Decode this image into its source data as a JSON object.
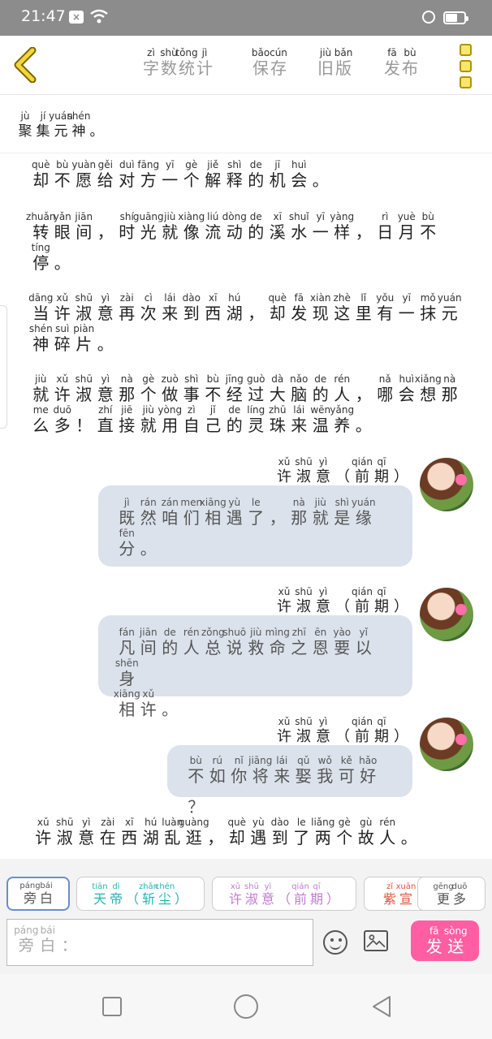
{
  "status": {
    "time": "21:47"
  },
  "toolbar": {
    "items": [
      {
        "name": "word-count",
        "chars": [
          [
            "zì",
            "字"
          ],
          [
            "shù",
            "数"
          ],
          [
            "tǒng",
            "统"
          ],
          [
            "jì",
            "计"
          ]
        ]
      },
      {
        "name": "save",
        "chars": [
          [
            "bǎo",
            "保"
          ],
          [
            "cún",
            "存"
          ]
        ]
      },
      {
        "name": "old-version",
        "chars": [
          [
            "jiù",
            "旧"
          ],
          [
            "bǎn",
            "版"
          ]
        ]
      },
      {
        "name": "publish",
        "chars": [
          [
            "fā",
            "发"
          ],
          [
            "bù",
            "布"
          ]
        ]
      }
    ]
  },
  "header_note": [
    [
      "jù",
      "聚"
    ],
    [
      "jí",
      "集"
    ],
    [
      "yuán",
      "元"
    ],
    [
      "shén",
      "神"
    ],
    [
      "",
      "。"
    ]
  ],
  "narration": [
    {
      "lines": [
        [
          [
            "què",
            "却"
          ],
          [
            "bù",
            "不"
          ],
          [
            "yuàn",
            "愿"
          ],
          [
            "gěi",
            "给"
          ],
          [
            "duì",
            "对"
          ],
          [
            "fāng",
            "方"
          ],
          [
            "yī",
            "一"
          ],
          [
            "gè",
            "个"
          ],
          [
            "jiě",
            "解"
          ],
          [
            "shì",
            "释"
          ],
          [
            "de",
            "的"
          ],
          [
            "jī",
            "机"
          ],
          [
            "huì",
            "会"
          ],
          [
            "",
            "。"
          ]
        ]
      ]
    },
    {
      "lines": [
        [
          [
            "zhuǎn",
            "转"
          ],
          [
            "yǎn",
            "眼"
          ],
          [
            "jiān",
            "间"
          ],
          [
            "",
            "，"
          ],
          [
            "shí",
            "时"
          ],
          [
            "guāng",
            "光"
          ],
          [
            "jiù",
            "就"
          ],
          [
            "xiàng",
            "像"
          ],
          [
            "liú",
            "流"
          ],
          [
            "dòng",
            "动"
          ],
          [
            "de",
            "的"
          ],
          [
            "xī",
            "溪"
          ],
          [
            "shuǐ",
            "水"
          ],
          [
            "yī",
            "一"
          ],
          [
            "yàng",
            "样"
          ],
          [
            "",
            "，"
          ],
          [
            "rì",
            "日"
          ],
          [
            "yuè",
            "月"
          ],
          [
            "bù",
            "不"
          ]
        ],
        [
          [
            "tíng",
            "停"
          ],
          [
            "",
            "。"
          ]
        ]
      ]
    },
    {
      "lines": [
        [
          [
            "dāng",
            "当"
          ],
          [
            "xǔ",
            "许"
          ],
          [
            "shū",
            "淑"
          ],
          [
            "yì",
            "意"
          ],
          [
            "zài",
            "再"
          ],
          [
            "cì",
            "次"
          ],
          [
            "lái",
            "来"
          ],
          [
            "dào",
            "到"
          ],
          [
            "xī",
            "西"
          ],
          [
            "hú",
            "湖"
          ],
          [
            "",
            "，"
          ],
          [
            "què",
            "却"
          ],
          [
            "fā",
            "发"
          ],
          [
            "xiàn",
            "现"
          ],
          [
            "zhè",
            "这"
          ],
          [
            "lǐ",
            "里"
          ],
          [
            "yǒu",
            "有"
          ],
          [
            "yī",
            "一"
          ],
          [
            "mǒ",
            "抹"
          ],
          [
            "yuán",
            "元"
          ]
        ],
        [
          [
            "shén",
            "神"
          ],
          [
            "suì",
            "碎"
          ],
          [
            "piàn",
            "片"
          ],
          [
            "",
            "。"
          ]
        ]
      ]
    },
    {
      "lines": [
        [
          [
            "jiù",
            "就"
          ],
          [
            "xǔ",
            "许"
          ],
          [
            "shū",
            "淑"
          ],
          [
            "yì",
            "意"
          ],
          [
            "nà",
            "那"
          ],
          [
            "gè",
            "个"
          ],
          [
            "zuò",
            "做"
          ],
          [
            "shì",
            "事"
          ],
          [
            "bù",
            "不"
          ],
          [
            "jīng",
            "经"
          ],
          [
            "guò",
            "过"
          ],
          [
            "dà",
            "大"
          ],
          [
            "nǎo",
            "脑"
          ],
          [
            "de",
            "的"
          ],
          [
            "rén",
            "人"
          ],
          [
            "",
            "，"
          ],
          [
            "nǎ",
            "哪"
          ],
          [
            "huì",
            "会"
          ],
          [
            "xiǎng",
            "想"
          ],
          [
            "nà",
            "那"
          ]
        ],
        [
          [
            "me",
            "么"
          ],
          [
            "duō",
            "多"
          ],
          [
            "",
            "！"
          ],
          [
            "zhí",
            "直"
          ],
          [
            "jiē",
            "接"
          ],
          [
            "jiù",
            "就"
          ],
          [
            "yòng",
            "用"
          ],
          [
            "zì",
            "自"
          ],
          [
            "jǐ",
            "己"
          ],
          [
            "de",
            "的"
          ],
          [
            "líng",
            "灵"
          ],
          [
            "zhū",
            "珠"
          ],
          [
            "lái",
            "来"
          ],
          [
            "wēn",
            "温"
          ],
          [
            "yǎng",
            "养"
          ],
          [
            "",
            "。"
          ]
        ]
      ]
    }
  ],
  "speaker": [
    [
      "xǔ",
      "许"
    ],
    [
      "shū",
      "淑"
    ],
    [
      "yì",
      "意"
    ],
    [
      "",
      "（"
    ],
    [
      "qián",
      "前"
    ],
    [
      "qī",
      "期"
    ],
    [
      "",
      "）"
    ]
  ],
  "messages": [
    {
      "lines": [
        [
          [
            "jì",
            "既"
          ],
          [
            "rán",
            "然"
          ],
          [
            "zán",
            "咱"
          ],
          [
            "men",
            "们"
          ],
          [
            "xiāng",
            "相"
          ],
          [
            "yù",
            "遇"
          ],
          [
            "le",
            "了"
          ],
          [
            "",
            "，"
          ],
          [
            "nà",
            "那"
          ],
          [
            "jiù",
            "就"
          ],
          [
            "shì",
            "是"
          ],
          [
            "yuán",
            "缘"
          ]
        ],
        [
          [
            "fēn",
            "分"
          ],
          [
            "",
            "。"
          ]
        ]
      ]
    },
    {
      "lines": [
        [
          [
            "fán",
            "凡"
          ],
          [
            "jiān",
            "间"
          ],
          [
            "de",
            "的"
          ],
          [
            "rén",
            "人"
          ],
          [
            "zǒng",
            "总"
          ],
          [
            "shuō",
            "说"
          ],
          [
            "jiù",
            "救"
          ],
          [
            "mìng",
            "命"
          ],
          [
            "zhī",
            "之"
          ],
          [
            "ēn",
            "恩"
          ],
          [
            "yào",
            "要"
          ],
          [
            "yǐ",
            "以"
          ],
          [
            "shēn",
            "身"
          ]
        ],
        [
          [
            "xiāng",
            "相"
          ],
          [
            "xǔ",
            "许"
          ],
          [
            "",
            "。"
          ]
        ]
      ]
    },
    {
      "lines": [
        [
          [
            "bù",
            "不"
          ],
          [
            "rú",
            "如"
          ],
          [
            "nǐ",
            "你"
          ],
          [
            "jiāng",
            "将"
          ],
          [
            "lái",
            "来"
          ],
          [
            "qǔ",
            "娶"
          ],
          [
            "wǒ",
            "我"
          ],
          [
            "kě",
            "可"
          ],
          [
            "hǎo",
            "好"
          ],
          [
            "",
            "？"
          ]
        ]
      ]
    }
  ],
  "last_narration": [
    [
      "xǔ",
      "许"
    ],
    [
      "shū",
      "淑"
    ],
    [
      "yì",
      "意"
    ],
    [
      "zài",
      "在"
    ],
    [
      "xī",
      "西"
    ],
    [
      "hú",
      "湖"
    ],
    [
      "luàn",
      "乱"
    ],
    [
      "guàng",
      "逛"
    ],
    [
      "",
      "，"
    ],
    [
      "què",
      "却"
    ],
    [
      "yù",
      "遇"
    ],
    [
      "dào",
      "到"
    ],
    [
      "le",
      "了"
    ],
    [
      "liǎng",
      "两"
    ],
    [
      "gè",
      "个"
    ],
    [
      "gù",
      "故"
    ],
    [
      "rén",
      "人"
    ],
    [
      "",
      "。"
    ]
  ],
  "roles": [
    {
      "name": "narrator",
      "color": "#555555",
      "chars": [
        [
          "páng",
          "旁"
        ],
        [
          "bái",
          "白"
        ]
      ]
    },
    {
      "name": "tiandi",
      "color": "#26b3b0",
      "chars": [
        [
          "tiān",
          "天"
        ],
        [
          "dì",
          "帝"
        ],
        [
          "",
          "（"
        ],
        [
          "zhǎn",
          "斩"
        ],
        [
          "chén",
          "尘"
        ],
        [
          "",
          "）"
        ]
      ]
    },
    {
      "name": "xushuyi",
      "color": "#c27ad1",
      "chars": [
        [
          "xǔ",
          "许"
        ],
        [
          "shū",
          "淑"
        ],
        [
          "yì",
          "意"
        ],
        [
          "",
          "（"
        ],
        [
          "qián",
          "前"
        ],
        [
          "qī",
          "期"
        ],
        [
          "",
          "）"
        ]
      ]
    },
    {
      "name": "zixuan",
      "color": "#e0523f",
      "chars": [
        [
          "zǐ",
          "紫"
        ],
        [
          "xuān",
          "宣"
        ]
      ]
    },
    {
      "name": "more",
      "color": "#555555",
      "chars": [
        [
          "gēng",
          "更"
        ],
        [
          "duō",
          "多"
        ]
      ]
    }
  ],
  "input": {
    "chars": [
      [
        "páng",
        "旁"
      ],
      [
        "bái",
        "白"
      ],
      [
        "",
        "："
      ]
    ]
  },
  "send": {
    "chars": [
      [
        "fā",
        "发"
      ],
      [
        "sòng",
        "送"
      ]
    ]
  }
}
